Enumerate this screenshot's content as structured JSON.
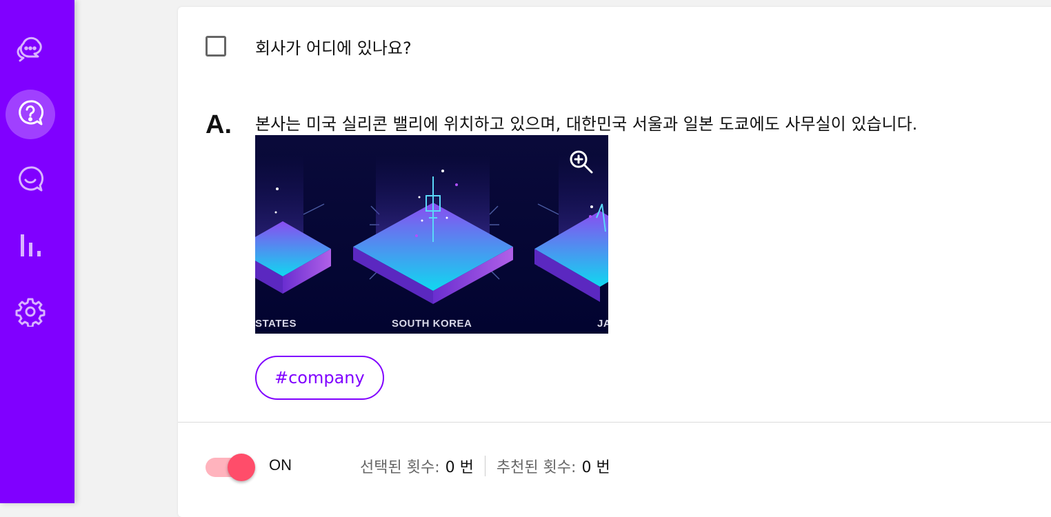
{
  "sidebar": {
    "items": [
      {
        "icon": "chat-bubbles-icon",
        "active": false
      },
      {
        "icon": "faq-question-icon",
        "active": true
      },
      {
        "icon": "smile-chat-icon",
        "active": false
      },
      {
        "icon": "bar-chart-icon",
        "active": false
      },
      {
        "icon": "gear-icon",
        "active": false
      }
    ],
    "color": "#8000ff"
  },
  "faq": {
    "question": "회사가 어디에 있나요?",
    "answer_mark": "A.",
    "answer": "본사는 미국 실리콘 밸리에 위치하고 있으며, 대한민국 서울과 일본 도쿄에도 사무실이 있습니다.",
    "image": {
      "labels": [
        "STATES",
        "SOUTH KOREA",
        "JA"
      ],
      "zoom_icon": "zoom-in-icon"
    },
    "tag": "#company",
    "toggle": {
      "label": "ON",
      "state": true
    },
    "stats": {
      "selected_label": "선택된 횟수:",
      "selected_value": "0 번",
      "recommended_label": "추천된 횟수:",
      "recommended_value": "0 번"
    }
  }
}
